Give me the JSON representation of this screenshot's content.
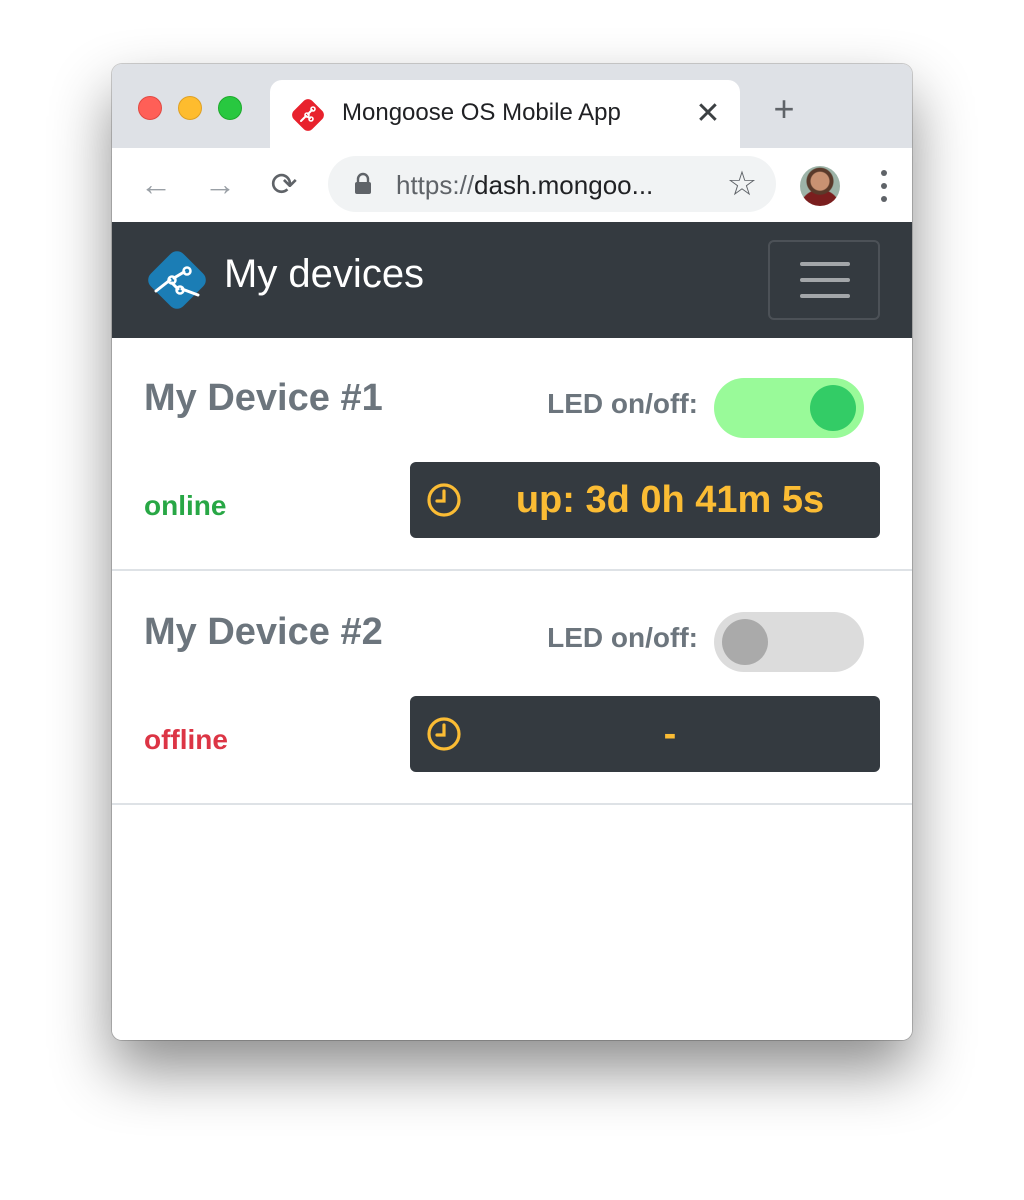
{
  "browser": {
    "tab_title": "Mongoose OS Mobile App",
    "tab_close": "✕",
    "new_tab": "+",
    "nav_back": "←",
    "nav_forward": "→",
    "nav_reload": "⟳",
    "url_scheme": "https://",
    "url_host": "dash.mongoo...",
    "bookmark_star": "☆",
    "icons": [
      "favicon-icon",
      "lock-icon",
      "star-icon",
      "menu-dots-icon"
    ]
  },
  "navbar": {
    "title": "My devices",
    "background": "#343a40"
  },
  "devices": [
    {
      "name": "My Device #1",
      "status": "online",
      "status_color": "#28a745",
      "led_label": "LED on/off:",
      "led_on": true,
      "uptime": "up: 3d 0h 41m 5s"
    },
    {
      "name": "My Device #2",
      "status": "offline",
      "status_color": "#dc3545",
      "led_label": "LED on/off:",
      "led_on": false,
      "uptime": "-"
    }
  ],
  "colors": {
    "switch_on_track": "#99fa99",
    "switch_on_knob": "#33cc66",
    "switch_off_track": "#dcdcdc",
    "switch_off_knob": "#aaaaaa",
    "uptime_text": "#fbbc34",
    "logo_blue": "#1b7db5",
    "favicon_red": "#e8222d"
  }
}
